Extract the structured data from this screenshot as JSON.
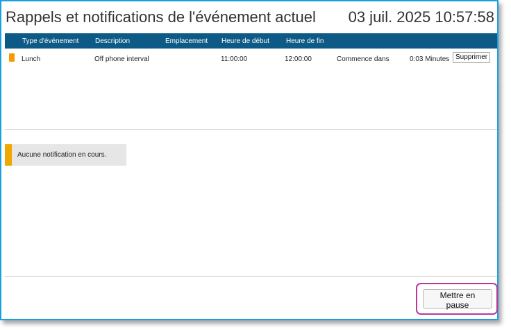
{
  "window": {
    "title": "Rappels et notifications de l'événement actuel",
    "clock": "03 juil. 2025 10:57:58",
    "border_color": "#1aa0e0"
  },
  "table": {
    "columns": [
      "Type d'événement",
      "Description",
      "Emplacement",
      "Heure de début",
      "Heure de fin"
    ],
    "header_color": "#0e5a86",
    "rows": [
      {
        "swatch_color": "#f59b00",
        "type": "Lunch",
        "description": "Off phone interval",
        "location": "",
        "start": "11:00:00",
        "end": "12:00:00",
        "status_label": "Commence dans",
        "countdown": "0:03 Minutes",
        "delete_label": "Supprimer"
      }
    ]
  },
  "notifications": {
    "empty_text": "Aucune notification en cours.",
    "accent_color": "#f0a800"
  },
  "footer": {
    "pause_label": "Mettre en pause",
    "highlight_color": "#b8399b"
  }
}
